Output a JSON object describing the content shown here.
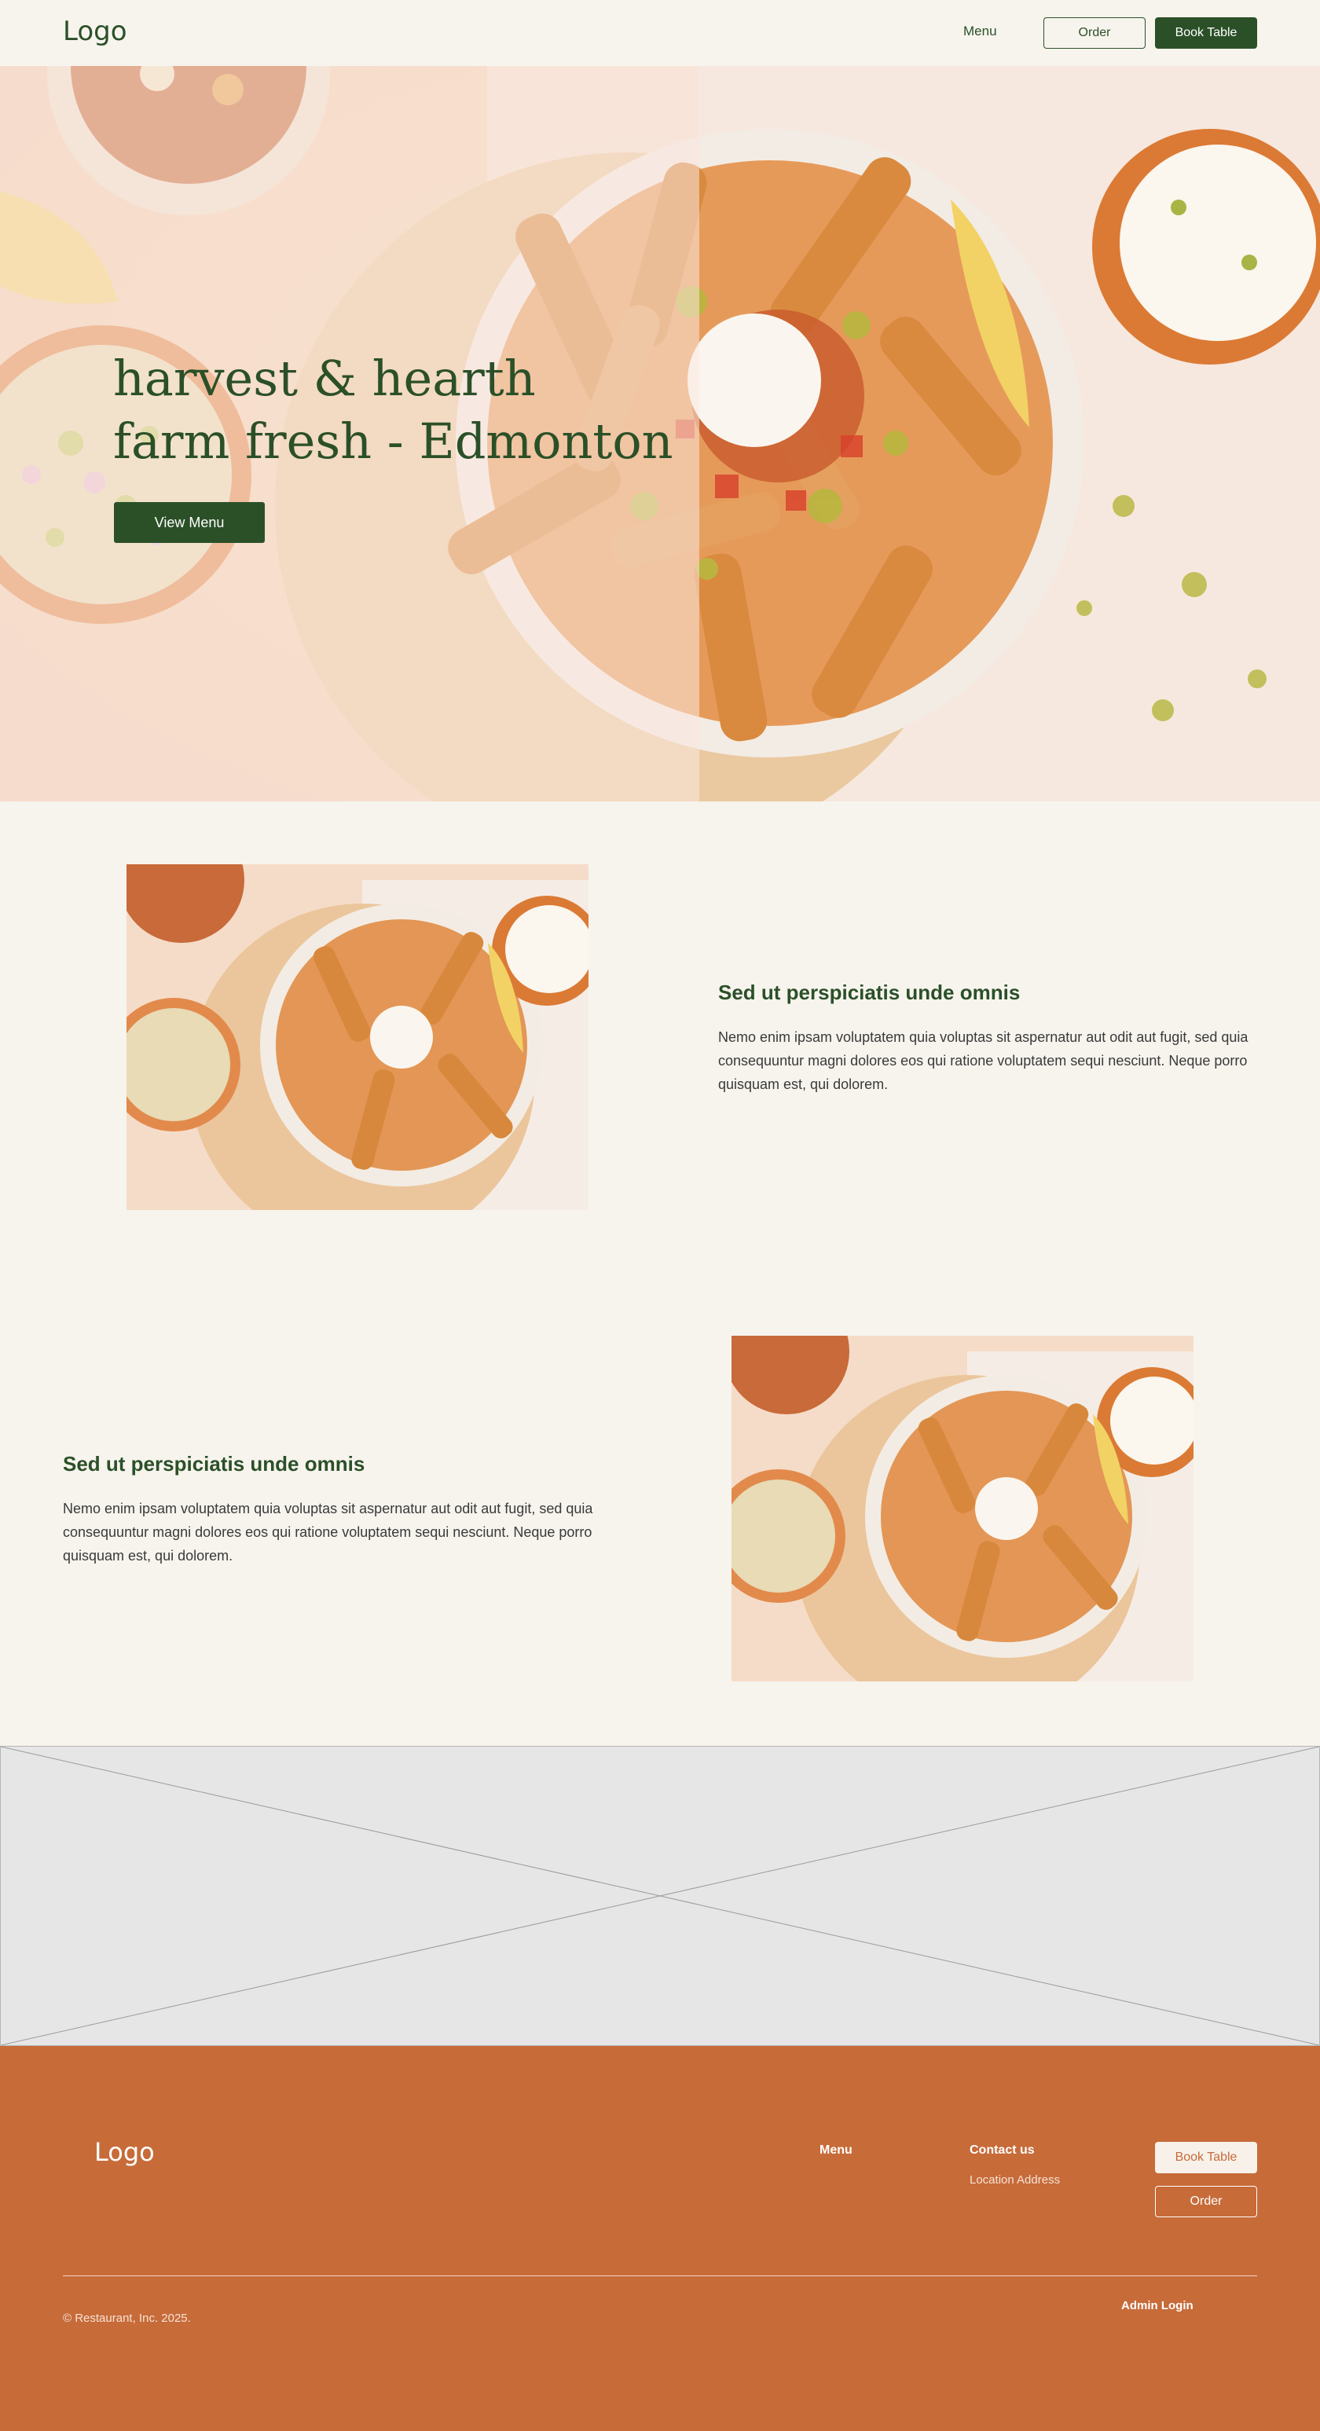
{
  "header": {
    "logo": "Logo",
    "nav_menu": "Menu",
    "order_label": "Order",
    "book_label": "Book Table"
  },
  "hero": {
    "title_line1": "harvest & hearth",
    "title_line2": "farm fresh - Edmonton",
    "cta_label": "View Menu"
  },
  "features": [
    {
      "heading": "Sed ut perspiciatis unde omnis",
      "body": "Nemo enim ipsam voluptatem quia voluptas sit aspernatur aut odit aut fugit, sed quia consequuntur magni dolores eos qui ratione voluptatem sequi nesciunt. Neque porro quisquam est, qui dolorem."
    },
    {
      "heading": "Sed ut perspiciatis unde omnis",
      "body": "Nemo enim ipsam voluptatem quia voluptas sit aspernatur aut odit aut fugit, sed quia consequuntur magni dolores eos qui ratione voluptatem sequi nesciunt. Neque porro quisquam est, qui dolorem."
    }
  ],
  "footer": {
    "logo": "Logo",
    "menu_heading": "Menu",
    "contact_heading": "Contact us",
    "location": "Location Address",
    "book_label": "Book Table",
    "order_label": "Order",
    "copyright": "© Restaurant, Inc. 2025.",
    "admin_login": "Admin Login"
  },
  "colors": {
    "brand_green": "#2b5028",
    "footer_orange": "#c76b39",
    "page_bg": "#f7f4ee"
  }
}
